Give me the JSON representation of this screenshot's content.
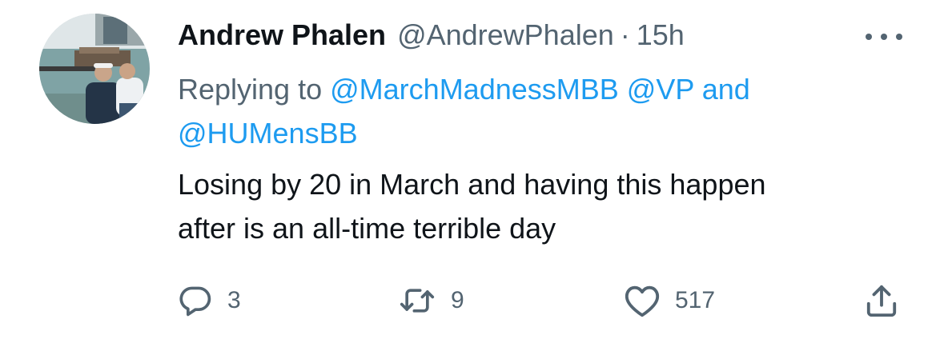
{
  "tweet": {
    "display_name": "Andrew Phalen",
    "handle": "@AndrewPhalen",
    "separator": "·",
    "time": "15h",
    "replying_prefix": "Replying to",
    "mention_1": "@MarchMadnessMBB",
    "mention_2": "@VP",
    "and_word": "and",
    "mention_3": "@HUMensBB",
    "text_line_1": "Losing by 20 in March and having this happen",
    "text_line_2": "after is an all-time terrible day"
  },
  "actions": {
    "reply_count": "3",
    "retweet_count": "9",
    "like_count": "517"
  },
  "icons": {
    "more": "more-horizontal-icon",
    "reply": "reply-bubble-icon",
    "retweet": "retweet-icon",
    "like": "heart-icon",
    "share": "share-upload-icon"
  },
  "colors": {
    "text": "#0f1419",
    "secondary": "#536471",
    "link": "#1d9bf0"
  }
}
